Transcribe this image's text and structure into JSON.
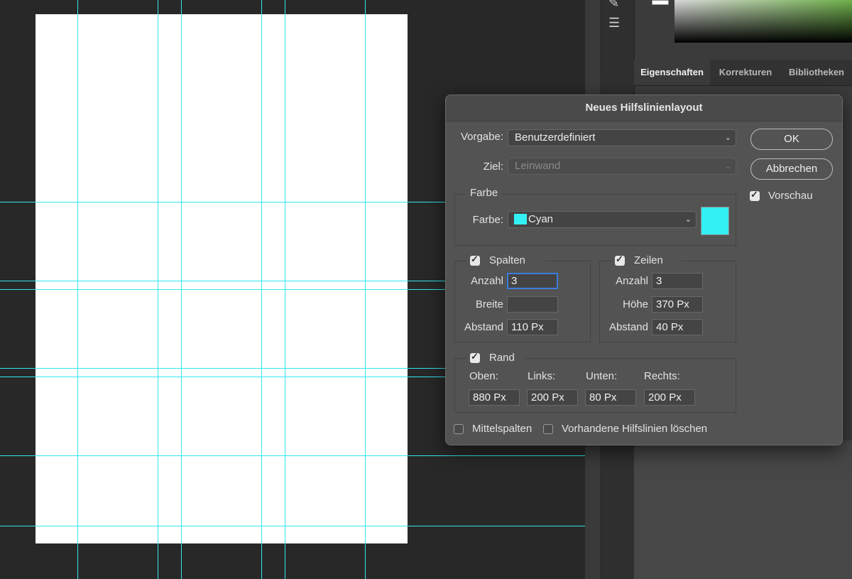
{
  "app": {
    "panel_tabs": [
      "Eigenschaften",
      "Korrekturen",
      "Bibliotheken"
    ],
    "accent_guide_color": "#33e6ee"
  },
  "dialog": {
    "title": "Neues Hilfslinienlayout",
    "preset": {
      "label": "Vorgabe:",
      "value": "Benutzerdefiniert"
    },
    "target": {
      "label": "Ziel:",
      "value": "Leinwand"
    },
    "color_group": {
      "title": "Farbe",
      "label": "Farbe:",
      "value": "Cyan",
      "color": "#33f0f5"
    },
    "columns": {
      "title": "Spalten",
      "checked": true,
      "count_label": "Anzahl",
      "count": "3",
      "width_label": "Breite",
      "width": "",
      "gutter_label": "Abstand",
      "gutter": "110 Px"
    },
    "rows": {
      "title": "Zeilen",
      "checked": true,
      "count_label": "Anzahl",
      "count": "3",
      "height_label": "Höhe",
      "height": "370 Px",
      "gutter_label": "Abstand",
      "gutter": "40 Px"
    },
    "margin": {
      "title": "Rand",
      "checked": true,
      "top_label": "Oben:",
      "top": "880 Px",
      "left_label": "Links:",
      "left": "200 Px",
      "bottom_label": "Unten:",
      "bottom": "80 Px",
      "right_label": "Rechts:",
      "right": "200 Px"
    },
    "center_columns": {
      "label": "Mittelspalten",
      "checked": false
    },
    "clear_existing": {
      "label": "Vorhandene Hilfslinien löschen",
      "checked": false
    },
    "ok_label": "OK",
    "cancel_label": "Abbrechen",
    "preview": {
      "label": "Vorschau",
      "checked": true
    }
  }
}
